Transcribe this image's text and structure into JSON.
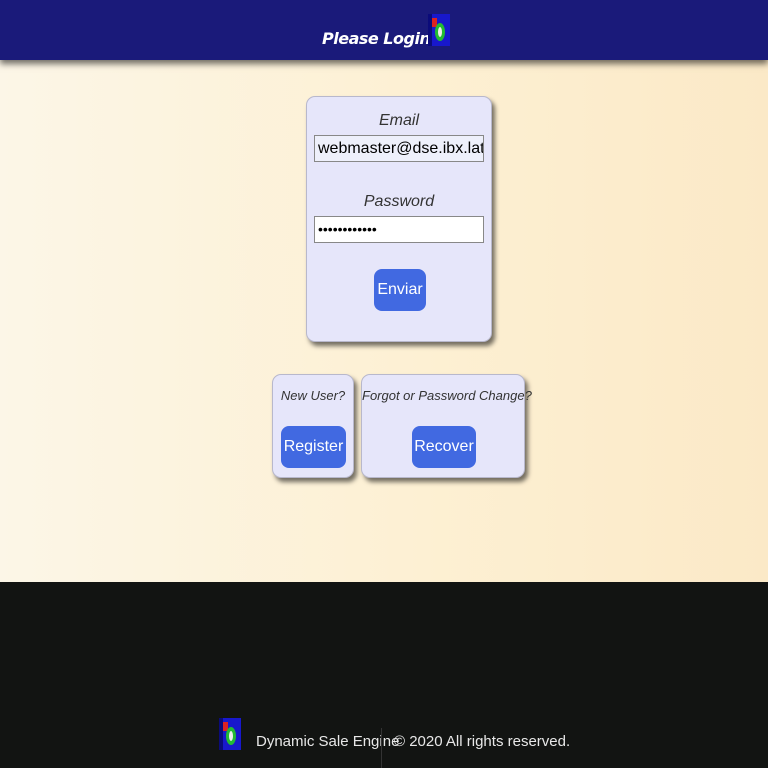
{
  "header": {
    "title": "Please Login",
    "logo_icon": "dse-logo-icon"
  },
  "login_form": {
    "email_label": "Email",
    "email_value": "webmaster@dse.ibx.lat",
    "password_label": "Password",
    "password_value": "••••••••••••",
    "submit_label": "Enviar"
  },
  "register_card": {
    "caption": "New User?",
    "button_label": "Register"
  },
  "recover_card": {
    "caption": "Forgot or Password Change?",
    "button_label": "Recover"
  },
  "footer": {
    "logo_icon": "dse-logo-icon",
    "brand": "Dynamic Sale Engine",
    "copyright": "© 2020 All rights reserved."
  },
  "colors": {
    "header_bg": "#1a1a7a",
    "card_bg": "#e6e6fa",
    "button_bg": "#4169e1",
    "footer_bg": "#121412",
    "page_bg": "#fdf0d3"
  }
}
